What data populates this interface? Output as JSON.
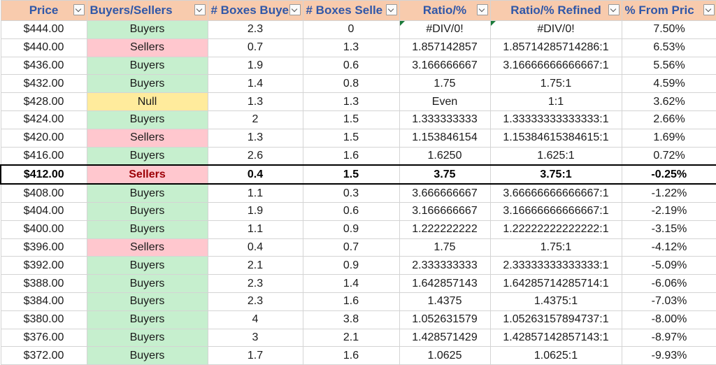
{
  "sheet": {
    "headers": [
      "Price",
      "Buyers/Sellers",
      "# Boxes Buye",
      "# Boxes Selle",
      "Ratio/%",
      "Ratio/% Refined",
      "% From Pric"
    ],
    "colors": {
      "header_bg": "#f8cbad",
      "header_text": "#3057a8",
      "buyers_bg": "#c6efce",
      "sellers_bg": "#ffc7ce",
      "null_bg": "#ffeb9c"
    },
    "highlight_price": "$412.00",
    "rows": [
      [
        "$444.00",
        "Buyers",
        "2.3",
        "0",
        "#DIV/0!",
        "#DIV/0!",
        "7.50%"
      ],
      [
        "$440.00",
        "Sellers",
        "0.7",
        "1.3",
        "1.857142857",
        "1.85714285714286:1",
        "6.53%"
      ],
      [
        "$436.00",
        "Buyers",
        "1.9",
        "0.6",
        "3.166666667",
        "3.16666666666667:1",
        "5.56%"
      ],
      [
        "$432.00",
        "Buyers",
        "1.4",
        "0.8",
        "1.75",
        "1.75:1",
        "4.59%"
      ],
      [
        "$428.00",
        "Null",
        "1.3",
        "1.3",
        "Even",
        "1:1",
        "3.62%"
      ],
      [
        "$424.00",
        "Buyers",
        "2",
        "1.5",
        "1.333333333",
        "1.33333333333333:1",
        "2.66%"
      ],
      [
        "$420.00",
        "Sellers",
        "1.3",
        "1.5",
        "1.153846154",
        "1.15384615384615:1",
        "1.69%"
      ],
      [
        "$416.00",
        "Buyers",
        "2.6",
        "1.6",
        "1.6250",
        "1.625:1",
        "0.72%"
      ],
      [
        "$412.00",
        "Sellers",
        "0.4",
        "1.5",
        "3.75",
        "3.75:1",
        "-0.25%"
      ],
      [
        "$408.00",
        "Buyers",
        "1.1",
        "0.3",
        "3.666666667",
        "3.66666666666667:1",
        "-1.22%"
      ],
      [
        "$404.00",
        "Buyers",
        "1.9",
        "0.6",
        "3.166666667",
        "3.16666666666667:1",
        "-2.19%"
      ],
      [
        "$400.00",
        "Buyers",
        "1.1",
        "0.9",
        "1.222222222",
        "1.22222222222222:1",
        "-3.15%"
      ],
      [
        "$396.00",
        "Sellers",
        "0.4",
        "0.7",
        "1.75",
        "1.75:1",
        "-4.12%"
      ],
      [
        "$392.00",
        "Buyers",
        "2.1",
        "0.9",
        "2.333333333",
        "2.33333333333333:1",
        "-5.09%"
      ],
      [
        "$388.00",
        "Buyers",
        "2.3",
        "1.4",
        "1.642857143",
        "1.64285714285714:1",
        "-6.06%"
      ],
      [
        "$384.00",
        "Buyers",
        "2.3",
        "1.6",
        "1.4375",
        "1.4375:1",
        "-7.03%"
      ],
      [
        "$380.00",
        "Buyers",
        "4",
        "3.8",
        "1.052631579",
        "1.05263157894737:1",
        "-8.00%"
      ],
      [
        "$376.00",
        "Buyers",
        "3",
        "2.1",
        "1.428571429",
        "1.42857142857143:1",
        "-8.97%"
      ],
      [
        "$372.00",
        "Buyers",
        "1.7",
        "1.6",
        "1.0625",
        "1.0625:1",
        "-9.93%"
      ]
    ]
  }
}
